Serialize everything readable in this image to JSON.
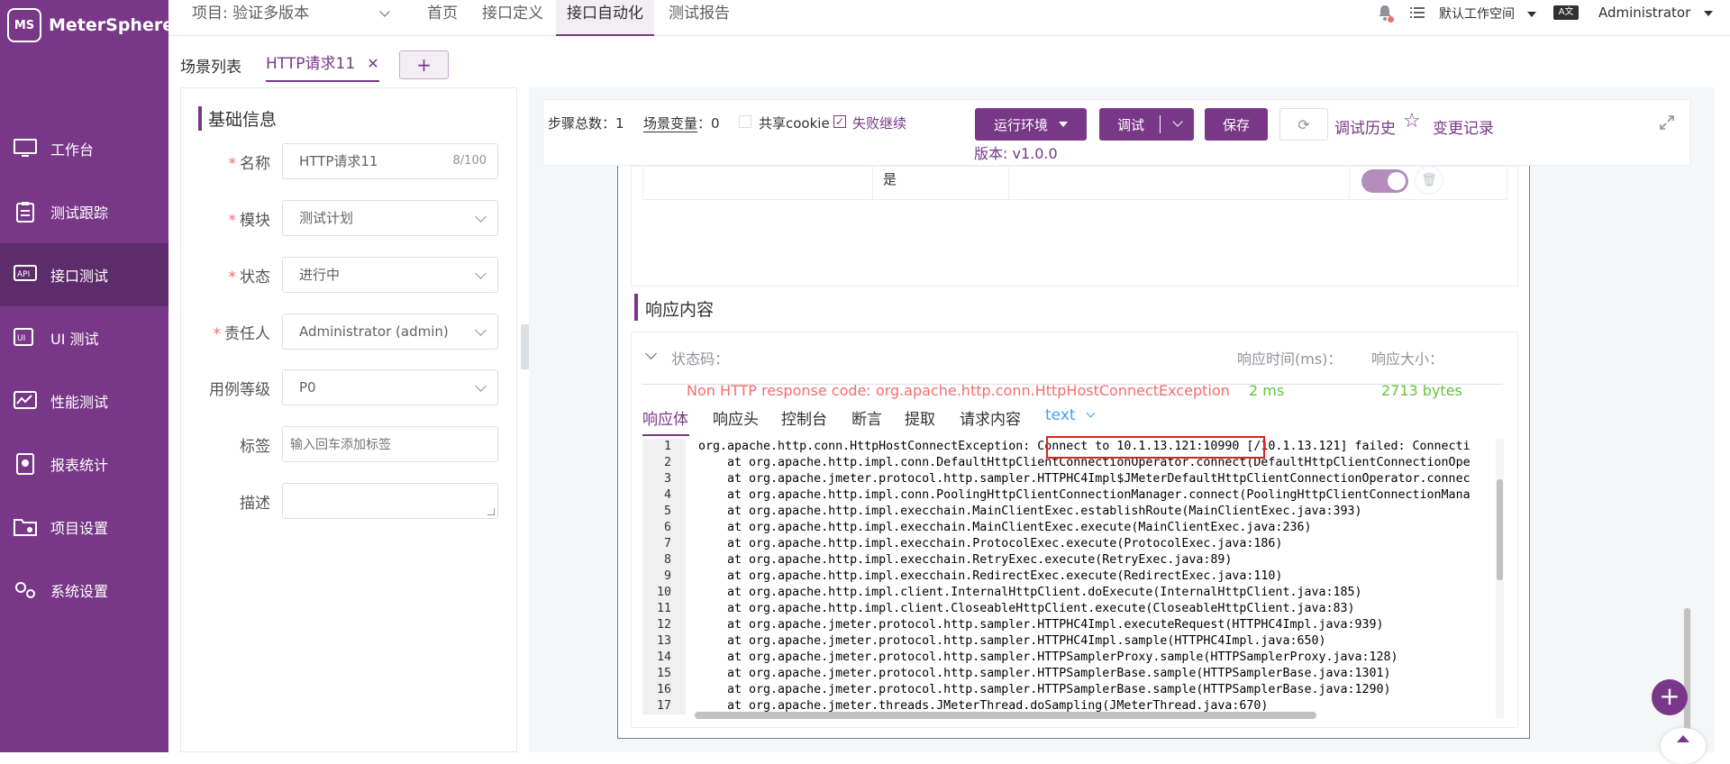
{
  "app": {
    "name": "MeterSphere"
  },
  "sidebar": {
    "items": [
      {
        "label": "工作台",
        "icon": "monitor-icon"
      },
      {
        "label": "测试跟踪",
        "icon": "clipboard-icon"
      },
      {
        "label": "接口测试",
        "icon": "api-icon",
        "active": true
      },
      {
        "label": "UI 测试",
        "icon": "ui-icon"
      },
      {
        "label": "性能测试",
        "icon": "performance-icon"
      },
      {
        "label": "报表统计",
        "icon": "report-icon"
      },
      {
        "label": "项目设置",
        "icon": "folder-settings-icon"
      },
      {
        "label": "系统设置",
        "icon": "gear-icon"
      }
    ]
  },
  "topbar": {
    "project": "项目: 验证多版本",
    "nav": [
      "首页",
      "接口定义",
      "接口自动化",
      "测试报告"
    ],
    "active_nav": "接口自动化",
    "workspace": "默认工作空间",
    "user": "Administrator"
  },
  "tabs": {
    "list_label": "场景列表",
    "current": "HTTP请求11",
    "add": "+"
  },
  "basic_info": {
    "title": "基础信息",
    "name_label": "名称",
    "name_value": "HTTP请求11",
    "name_count": "8/100",
    "module_label": "模块",
    "module_value": "测试计划",
    "status_label": "状态",
    "status_value": "进行中",
    "owner_label": "责任人",
    "owner_value": "Administrator (admin)",
    "level_label": "用例等级",
    "level_value": "P0",
    "tags_label": "标签",
    "tags_placeholder": "输入回车添加标签",
    "desc_label": "描述"
  },
  "toolbar": {
    "steps_label": "步骤总数：",
    "steps_count": "1",
    "vars_label": "场景变量",
    "vars_sep": "：",
    "vars_count": "0",
    "share_cookie": "共享cookie",
    "continue_on_fail": "失败继续",
    "env_btn": "运行环境",
    "debug_btn": "调试",
    "save_btn": "保存",
    "history": "调试历史",
    "changelog": "变更记录",
    "version": "版本: v1.0.0"
  },
  "table_row": {
    "value": "是"
  },
  "response": {
    "title": "响应内容",
    "status_label": "状态码：",
    "time_label": "响应时间(ms)：",
    "size_label": "响应大小：",
    "status_value": "Non HTTP response code: org.apache.http.conn.HttpHostConnectException",
    "time_value": "2 ms",
    "size_value": "2713 bytes",
    "tabs": [
      "响应体",
      "响应头",
      "控制台",
      "断言",
      "提取",
      "请求内容"
    ],
    "format": "text",
    "lines": [
      "org.apache.http.conn.HttpHostConnectException: Connect to 10.1.13.121:10990 [/10.1.13.121] failed: Connecti",
      "    at org.apache.http.impl.conn.DefaultHttpClientConnectionOperator.connect(DefaultHttpClientConnectionOpe",
      "    at org.apache.jmeter.protocol.http.sampler.HTTPHC4Impl$JMeterDefaultHttpClientConnectionOperator.connec",
      "    at org.apache.http.impl.conn.PoolingHttpClientConnectionManager.connect(PoolingHttpClientConnectionMana",
      "    at org.apache.http.impl.execchain.MainClientExec.establishRoute(MainClientExec.java:393)",
      "    at org.apache.http.impl.execchain.MainClientExec.execute(MainClientExec.java:236)",
      "    at org.apache.http.impl.execchain.ProtocolExec.execute(ProtocolExec.java:186)",
      "    at org.apache.http.impl.execchain.RetryExec.execute(RetryExec.java:89)",
      "    at org.apache.http.impl.execchain.RedirectExec.execute(RedirectExec.java:110)",
      "    at org.apache.http.impl.client.InternalHttpClient.doExecute(InternalHttpClient.java:185)",
      "    at org.apache.http.impl.client.CloseableHttpClient.execute(CloseableHttpClient.java:83)",
      "    at org.apache.jmeter.protocol.http.sampler.HTTPHC4Impl.executeRequest(HTTPHC4Impl.java:939)",
      "    at org.apache.jmeter.protocol.http.sampler.HTTPHC4Impl.sample(HTTPHC4Impl.java:650)",
      "    at org.apache.jmeter.protocol.http.sampler.HTTPSamplerProxy.sample(HTTPSamplerProxy.java:128)",
      "    at org.apache.jmeter.protocol.http.sampler.HTTPSamplerBase.sample(HTTPSamplerBase.java:1301)",
      "    at org.apache.jmeter.protocol.http.sampler.HTTPSamplerBase.sample(HTTPSamplerBase.java:1290)",
      "    at org.apache.jmeter.threads.JMeterThread.doSampling(JMeterThread.java:670)"
    ]
  },
  "colors": {
    "brand": "#783887",
    "error": "#f56c6c",
    "success": "#67c23a",
    "highlight": "#e02020"
  }
}
